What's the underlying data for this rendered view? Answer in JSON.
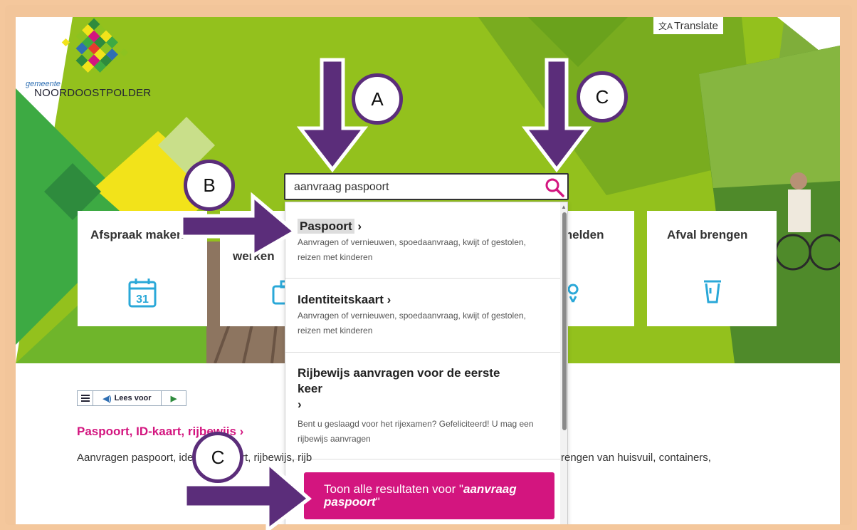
{
  "site": {
    "logo_small": "gemeente",
    "logo_big": "NOORDOOSTPOLDER",
    "translate_label": "Translate",
    "translate_icon": "translate-icon"
  },
  "search": {
    "value": "aanvraag paspoort",
    "icon": "search-icon"
  },
  "tiles": [
    {
      "title": "Afspraak maken",
      "icon": "calendar-icon",
      "icon_text": "31"
    },
    {
      "title": "werken",
      "icon": "briefcase-icon"
    },
    {
      "title": "melden",
      "icon": "map-pin-icon"
    },
    {
      "title": "Afval brengen",
      "icon": "waste-bin-icon"
    }
  ],
  "results": [
    {
      "title": "Paspoort",
      "desc": "Aanvragen of vernieuwen, spoedaanvraag, kwijt of gestolen, reizen met kinderen"
    },
    {
      "title": "Identiteitskaart",
      "desc": "Aanvragen of vernieuwen, spoedaanvraag, kwijt of gestolen, reizen met kinderen"
    },
    {
      "title_line1": "Rijbewijs aanvragen voor de eerste",
      "title_line2": "keer",
      "desc": "Bent u geslaagd voor het rijexamen? Gefeliciteerd! U mag een rijbewijs aanvragen"
    }
  ],
  "show_all": {
    "prefix": "Toon alle resultaten voor \"",
    "query": "aanvraag paspoort",
    "suffix": "\""
  },
  "read_speaker": {
    "label": "Lees voor"
  },
  "category": {
    "title": "Paspoort, ID-kaart, rijbewijs",
    "desc_left": "Aanvragen paspoort, identiteitskaart, rijbewijs, rijb",
    "desc_right": "rengen van huisvuil, containers,"
  },
  "annotations": [
    {
      "label": "A"
    },
    {
      "label": "B"
    },
    {
      "label": "C"
    },
    {
      "label": "C"
    }
  ],
  "colors": {
    "magenta": "#d3157f",
    "green": "#8dc21f",
    "purple_annotation": "#5b2d7a"
  }
}
